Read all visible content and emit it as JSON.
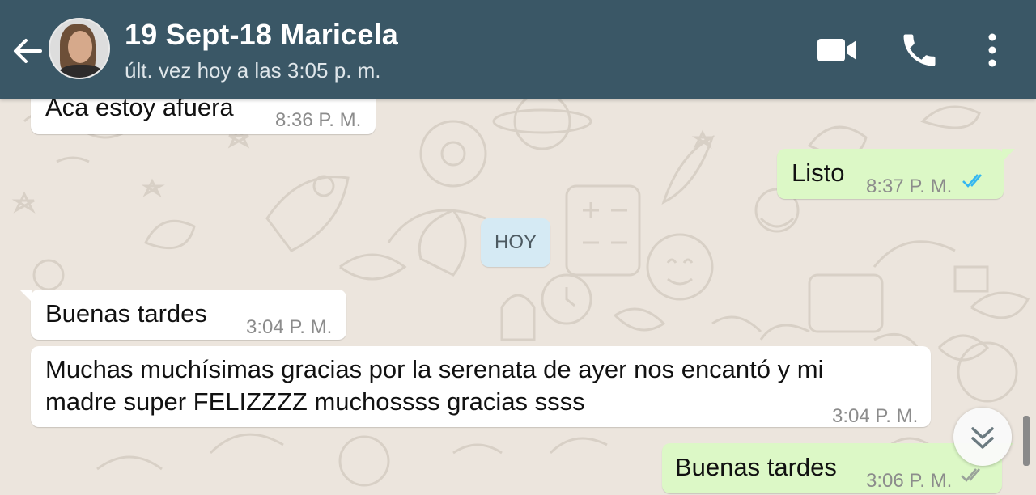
{
  "header": {
    "contact_name": "19 Sept-18 Maricela",
    "last_seen": "últ. vez hoy a las 3:05 p. m."
  },
  "messages": [
    {
      "direction": "incoming",
      "text": "Aca estoy afuera",
      "time": "8:36 P. M."
    },
    {
      "direction": "outgoing",
      "text": "Listo",
      "time": "8:37 P. M.",
      "status": "read"
    },
    {
      "direction": "incoming",
      "text": "Buenas tardes",
      "time": "3:04 P. M."
    },
    {
      "direction": "incoming",
      "lines": [
        "Muchas muchísimas gracias por la serenata de ayer nos encantó y mi",
        "madre super FELIZZZZ muchossss gracias ssss"
      ],
      "time": "3:04 P. M."
    },
    {
      "direction": "outgoing",
      "text": "Buenas tardes",
      "time": "3:06 P. M.",
      "status": "delivered"
    }
  ],
  "day_divider": "HOY",
  "icons": {
    "back": "arrow-left-icon",
    "video": "video-camera-icon",
    "phone": "phone-icon",
    "menu": "more-vertical-icon",
    "scroll": "double-chevron-down-icon"
  },
  "colors": {
    "header": "#3a5766",
    "chat_background": "#ece5dd",
    "outgoing_bubble": "#dcf8c6",
    "incoming_bubble": "#ffffff",
    "day_chip": "#d5eaf4",
    "read_tick": "#34b7f1"
  }
}
